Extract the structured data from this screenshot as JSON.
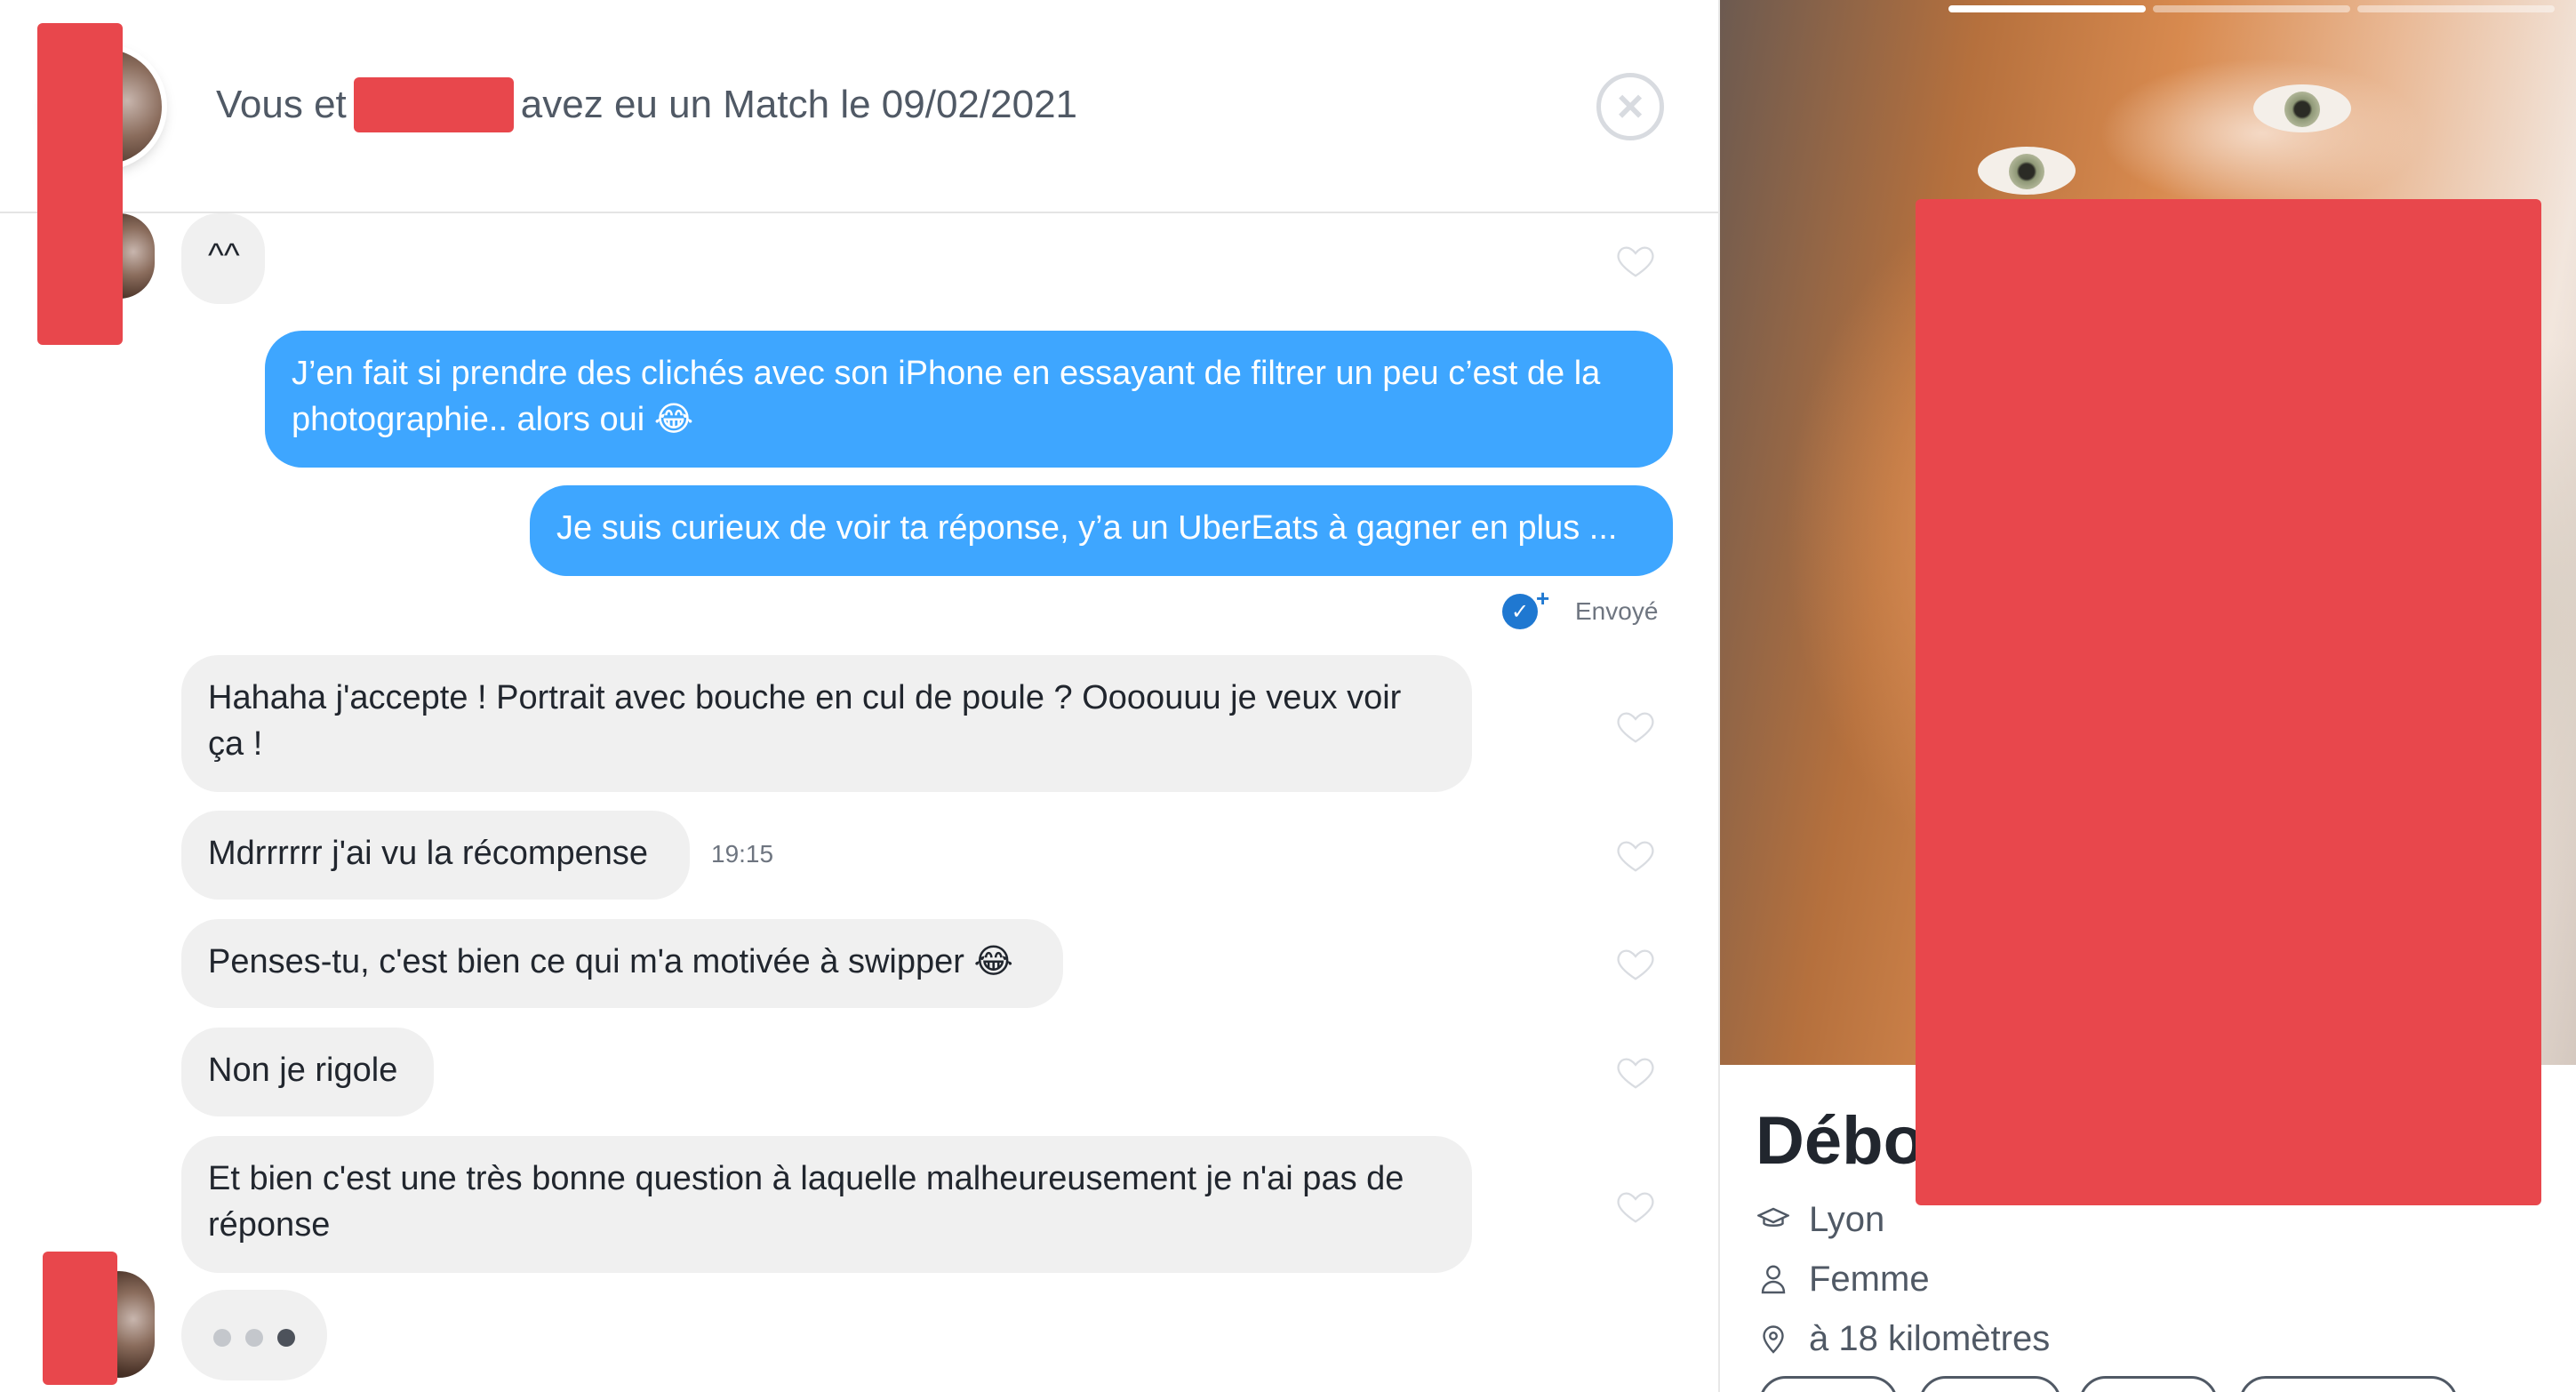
{
  "header": {
    "prefix": "Vous et",
    "suffix": "avez eu un Match le 09/02/2021",
    "close_label": "×"
  },
  "messages": [
    {
      "id": "m1",
      "from": "them",
      "text": "^^"
    },
    {
      "id": "m2",
      "from": "me",
      "text": "J’en fait si prendre des clichés avec son iPhone en essayant de filtrer un peu c’est de la photographie.. alors oui 😂"
    },
    {
      "id": "m3",
      "from": "me",
      "text": "Je suis curieux de voir ta réponse, y’a un UberEats à gagner en plus ..."
    },
    {
      "id": "m4",
      "from": "them",
      "text": "Hahaha j'accepte ! Portrait avec bouche en cul de poule ? Oooouuu je veux voir ça !"
    },
    {
      "id": "m5",
      "from": "them",
      "text": "Mdrrrrrr j'ai vu la récompense",
      "time": "19:15"
    },
    {
      "id": "m6",
      "from": "them",
      "text": "Penses-tu, c'est bien ce qui m'a motivée à swipper 😂"
    },
    {
      "id": "m7",
      "from": "them",
      "text": "Non je rigole"
    },
    {
      "id": "m8",
      "from": "them",
      "text": "Et bien c'est une très bonne question à laquelle malheureusement je n'ai pas de réponse"
    }
  ],
  "delivery": {
    "status": "Envoyé",
    "check": "✓",
    "plus": "+"
  },
  "profile": {
    "name": "Débo",
    "city": "Lyon",
    "gender": "Femme",
    "distance": "à 18 kilomètres",
    "photo_count": 3,
    "active_photo": 1
  },
  "colors": {
    "sent_bubble": "#3ea6ff",
    "received_bubble": "#f0f0f0",
    "redaction": "#e8474c",
    "delivered_check": "#1f78d1"
  },
  "icons": {
    "close": "close-icon",
    "heart": "heart-icon",
    "education": "graduation-cap-icon",
    "gender": "person-icon",
    "location": "location-pin-icon",
    "delivered": "double-check-icon"
  }
}
